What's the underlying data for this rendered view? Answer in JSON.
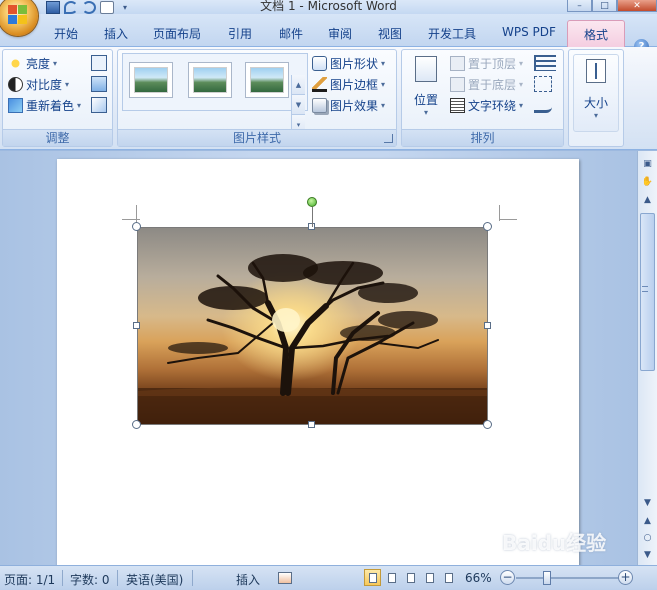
{
  "window": {
    "title": "文档 1 - Microsoft Word",
    "controls": {
      "minimize": "–",
      "maximize": "□",
      "close": "✕"
    }
  },
  "tabs": [
    "开始",
    "插入",
    "页面布局",
    "引用",
    "邮件",
    "审阅",
    "视图",
    "开发工具",
    "WPS PDF",
    "格式"
  ],
  "active_tab": "格式",
  "help": "?",
  "ribbon": {
    "adjust": {
      "label": "调整",
      "commands": [
        "亮度",
        "对比度",
        "重新着色"
      ]
    },
    "picture_styles": {
      "label": "图片样式",
      "commands": [
        "图片形状",
        "图片边框",
        "图片效果"
      ]
    },
    "arrange": {
      "label": "排列",
      "position": "位置",
      "commands": [
        "置于顶层",
        "置于底层",
        "文字环绕"
      ]
    },
    "size": {
      "label": "大小"
    }
  },
  "statusbar": {
    "page": "页面: 1/1",
    "words": "字数: 0",
    "language": "英语(美国)",
    "mode": "插入",
    "zoom": "66%",
    "zoom_minus": "−",
    "zoom_plus": "+"
  },
  "scrollbar": {
    "up": "▲",
    "down": "▼",
    "prev": "▲",
    "select": "○",
    "next": "▼"
  },
  "watermark": "Baidu经验",
  "colors": {
    "ribbon_text": "#15428b",
    "tab_active_bg": "#f4cde0",
    "chrome_blue": "#c4d6ef"
  }
}
